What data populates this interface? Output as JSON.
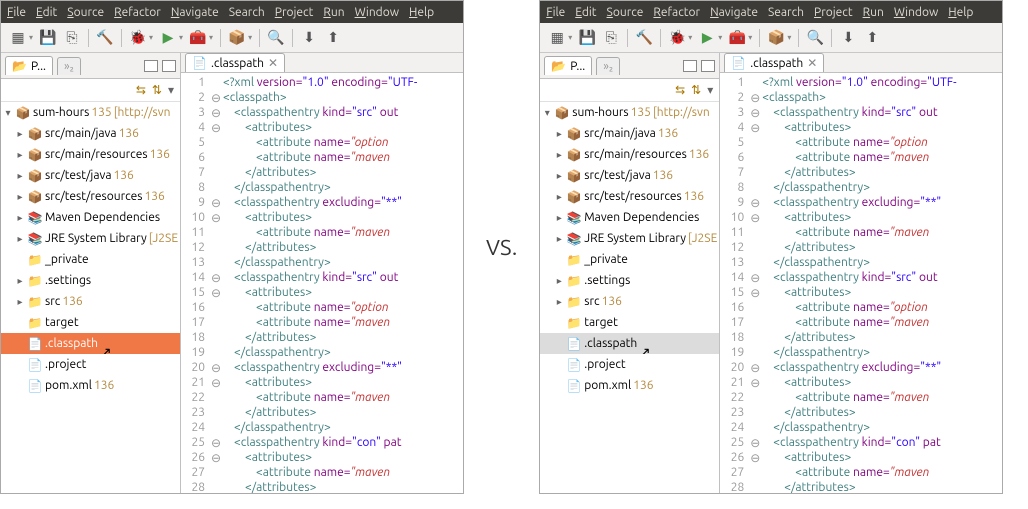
{
  "menubar": [
    "File",
    "Edit",
    "Source",
    "Refactor",
    "Navigate",
    "Search",
    "Project",
    "Run",
    "Window",
    "Help"
  ],
  "menubar_accel": [
    0,
    0,
    0,
    0,
    0,
    -1,
    0,
    0,
    0,
    0
  ],
  "vs": "VS.",
  "nav": {
    "tab1": "P...",
    "tab2": "»₂"
  },
  "tree": [
    {
      "depth": 0,
      "tw": "▾",
      "ico": "📦",
      "label": "sum-hours",
      "rev": "135",
      "extra": "[http://svn"
    },
    {
      "depth": 1,
      "tw": "▸",
      "ico": "📦",
      "label": "src/main/java",
      "rev": "136"
    },
    {
      "depth": 1,
      "tw": "▸",
      "ico": "📦",
      "label": "src/main/resources",
      "rev": "136"
    },
    {
      "depth": 1,
      "tw": "▸",
      "ico": "📦",
      "label": "src/test/java",
      "rev": "136"
    },
    {
      "depth": 1,
      "tw": "▸",
      "ico": "📦",
      "label": "src/test/resources",
      "rev": "136"
    },
    {
      "depth": 1,
      "tw": "▸",
      "ico": "📚",
      "label": "Maven Dependencies"
    },
    {
      "depth": 1,
      "tw": "▸",
      "ico": "📚",
      "label": "JRE System Library",
      "extra": "[J2SE"
    },
    {
      "depth": 1,
      "tw": "",
      "ico": "📁",
      "label": "_private"
    },
    {
      "depth": 1,
      "tw": "▸",
      "ico": "📁",
      "label": ".settings"
    },
    {
      "depth": 1,
      "tw": "▸",
      "ico": "📁",
      "label": "src",
      "rev": "136"
    },
    {
      "depth": 1,
      "tw": "",
      "ico": "📁",
      "label": "target"
    },
    {
      "depth": 1,
      "tw": "",
      "ico": "📄",
      "label": ".classpath",
      "sel": true
    },
    {
      "depth": 1,
      "tw": "",
      "ico": "📄",
      "label": ".project"
    },
    {
      "depth": 1,
      "tw": "",
      "ico": "📄",
      "label": "pom.xml",
      "rev": "136"
    }
  ],
  "editor": {
    "tab": ".classpath"
  },
  "code": [
    {
      "ln": 1,
      "fold": "",
      "t": [
        "pi",
        "<?xml "
      ],
      "a": [
        [
          "attrn",
          "version="
        ],
        [
          "attrv-blue",
          "\"1.0\" "
        ],
        [
          "attrn",
          "encoding="
        ],
        [
          "attrv-blue",
          "\"UTF-"
        ]
      ]
    },
    {
      "ln": 2,
      "fold": "⊖",
      "t": [
        "tag",
        "<classpath>"
      ]
    },
    {
      "ln": 3,
      "fold": "⊖",
      "t": [
        "tag",
        "    <classpathentry "
      ],
      "a": [
        [
          "attrn",
          "kind="
        ],
        [
          "attrv-blue",
          "\"src\" "
        ],
        [
          "attrn",
          "out"
        ]
      ]
    },
    {
      "ln": 4,
      "fold": "⊖",
      "t": [
        "tag",
        "        <attributes>"
      ]
    },
    {
      "ln": 5,
      "fold": "",
      "t": [
        "tag",
        "            <attribute "
      ],
      "a": [
        [
          "attrn",
          "name="
        ],
        [
          "attrv-red",
          "\"option"
        ]
      ]
    },
    {
      "ln": 6,
      "fold": "",
      "t": [
        "tag",
        "            <attribute "
      ],
      "a": [
        [
          "attrn",
          "name="
        ],
        [
          "attrv-red",
          "\"maven"
        ]
      ]
    },
    {
      "ln": 7,
      "fold": "",
      "t": [
        "tag",
        "        </attributes>"
      ]
    },
    {
      "ln": 8,
      "fold": "",
      "t": [
        "tag",
        "    </classpathentry>"
      ]
    },
    {
      "ln": 9,
      "fold": "⊖",
      "t": [
        "tag",
        "    <classpathentry "
      ],
      "a": [
        [
          "attrn",
          "excluding="
        ],
        [
          "attrv-blue",
          "\"**\""
        ]
      ]
    },
    {
      "ln": 10,
      "fold": "⊖",
      "t": [
        "tag",
        "        <attributes>"
      ]
    },
    {
      "ln": 11,
      "fold": "",
      "t": [
        "tag",
        "            <attribute "
      ],
      "a": [
        [
          "attrn",
          "name="
        ],
        [
          "attrv-red",
          "\"maven"
        ]
      ]
    },
    {
      "ln": 12,
      "fold": "",
      "t": [
        "tag",
        "        </attributes>"
      ]
    },
    {
      "ln": 13,
      "fold": "",
      "t": [
        "tag",
        "    </classpathentry>"
      ]
    },
    {
      "ln": 14,
      "fold": "⊖",
      "t": [
        "tag",
        "    <classpathentry "
      ],
      "a": [
        [
          "attrn",
          "kind="
        ],
        [
          "attrv-blue",
          "\"src\" "
        ],
        [
          "attrn",
          "out"
        ]
      ]
    },
    {
      "ln": 15,
      "fold": "⊖",
      "t": [
        "tag",
        "        <attributes>"
      ]
    },
    {
      "ln": 16,
      "fold": "",
      "t": [
        "tag",
        "            <attribute "
      ],
      "a": [
        [
          "attrn",
          "name="
        ],
        [
          "attrv-red",
          "\"option"
        ]
      ]
    },
    {
      "ln": 17,
      "fold": "",
      "t": [
        "tag",
        "            <attribute "
      ],
      "a": [
        [
          "attrn",
          "name="
        ],
        [
          "attrv-red",
          "\"maven"
        ]
      ]
    },
    {
      "ln": 18,
      "fold": "",
      "t": [
        "tag",
        "        </attributes>"
      ]
    },
    {
      "ln": 19,
      "fold": "",
      "t": [
        "tag",
        "    </classpathentry>"
      ]
    },
    {
      "ln": 20,
      "fold": "⊖",
      "t": [
        "tag",
        "    <classpathentry "
      ],
      "a": [
        [
          "attrn",
          "excluding="
        ],
        [
          "attrv-blue",
          "\"**\""
        ]
      ]
    },
    {
      "ln": 21,
      "fold": "⊖",
      "t": [
        "tag",
        "        <attributes>"
      ]
    },
    {
      "ln": 22,
      "fold": "",
      "t": [
        "tag",
        "            <attribute "
      ],
      "a": [
        [
          "attrn",
          "name="
        ],
        [
          "attrv-red",
          "\"maven"
        ]
      ]
    },
    {
      "ln": 23,
      "fold": "",
      "t": [
        "tag",
        "        </attributes>"
      ]
    },
    {
      "ln": 24,
      "fold": "",
      "t": [
        "tag",
        "    </classpathentry>"
      ]
    },
    {
      "ln": 25,
      "fold": "⊖",
      "t": [
        "tag",
        "    <classpathentry "
      ],
      "a": [
        [
          "attrn",
          "kind="
        ],
        [
          "attrv-blue",
          "\"con\" "
        ],
        [
          "attrn",
          "pat"
        ]
      ]
    },
    {
      "ln": 26,
      "fold": "⊖",
      "t": [
        "tag",
        "        <attributes>"
      ]
    },
    {
      "ln": 27,
      "fold": "",
      "t": [
        "tag",
        "            <attribute "
      ],
      "a": [
        [
          "attrn",
          "name="
        ],
        [
          "attrv-red",
          "\"maven"
        ]
      ]
    },
    {
      "ln": 28,
      "fold": "",
      "t": [
        "tag",
        "        </attributes>"
      ]
    }
  ],
  "sel_style": [
    "sel-orange",
    "sel-gray"
  ]
}
